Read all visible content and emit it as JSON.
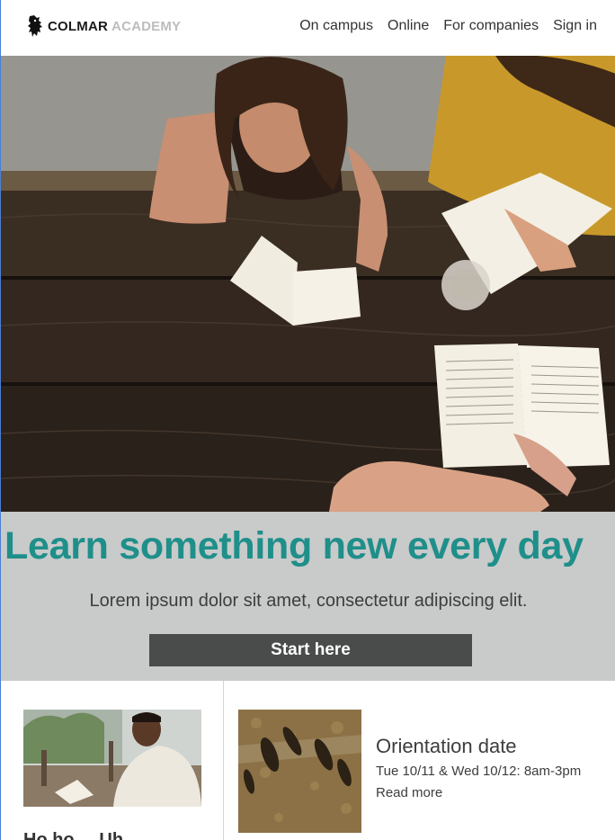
{
  "brand": {
    "name_primary": "COLMAR",
    "name_secondary": "ACADEMY",
    "icon": "lion-icon"
  },
  "nav": {
    "items": [
      {
        "label": "On campus"
      },
      {
        "label": "Online"
      },
      {
        "label": "For companies"
      },
      {
        "label": "Sign in"
      }
    ]
  },
  "hero": {
    "image": "students-reading-at-table-photo"
  },
  "banner": {
    "title": "Learn something new every day",
    "subtitle": "Lorem ipsum dolor sit amet, consectetur adipiscing elit.",
    "cta_label": "Start here",
    "colors": {
      "background": "#c9caca",
      "title": "#1f8f8a",
      "button": "#4a4b4b"
    }
  },
  "cards": {
    "left": {
      "image": "student-with-book-photo",
      "title": "Ho ho ... Uh ..."
    },
    "right": {
      "image": "people-shadows-photo",
      "title": "Orientation date",
      "date": "Tue 10/11 & Wed 10/12: 8am-3pm",
      "link": "Read more"
    }
  }
}
